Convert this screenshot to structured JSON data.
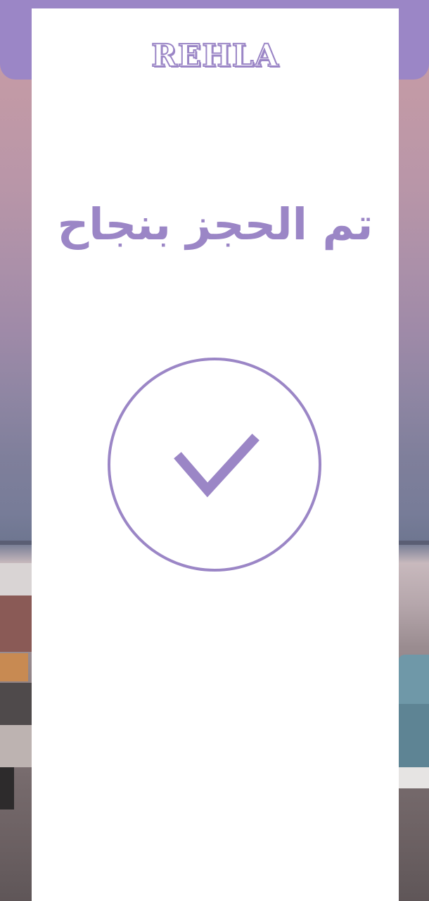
{
  "brand": {
    "logo_text": "REHLA",
    "accent_color": "#9b86c6"
  },
  "confirmation": {
    "title": "تم الحجز بنجاح",
    "status_icon": "checkmark-circle-icon"
  }
}
